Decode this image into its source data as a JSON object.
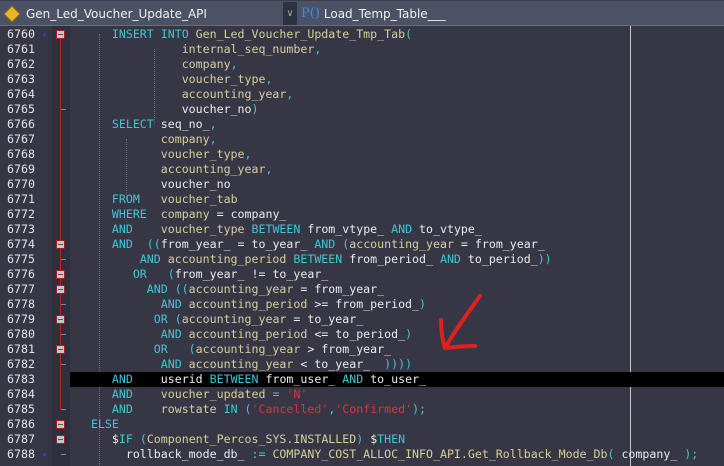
{
  "header": {
    "object_name": "Gen_Led_Voucher_Update_API",
    "object_icon": "package-icon",
    "procedure_name": "Load_Temp_Table___",
    "procedure_icon": "procedure-icon",
    "dropdown_icon": "chevron-down-icon"
  },
  "colors": {
    "keyword": "#3ec8d6",
    "column": "#d8cf9c",
    "string": "#d23a3a",
    "annotation_arrow": "#e02020"
  },
  "editor": {
    "highlighted_line": "6783",
    "lines": [
      {
        "n": "6760",
        "fold": "box",
        "bp": true,
        "seg": [
          [
            "",
            "      "
          ],
          [
            "k",
            "INSERT INTO "
          ],
          [
            "c",
            "Gen_Led_Voucher_Update_Tmp_Tab"
          ],
          [
            "p",
            "("
          ]
        ]
      },
      {
        "n": "6761",
        "seg": [
          [
            "",
            "                "
          ],
          [
            "c",
            "internal_seq_number"
          ],
          [
            "p",
            ","
          ]
        ]
      },
      {
        "n": "6762",
        "seg": [
          [
            "",
            "                "
          ],
          [
            "c",
            "company"
          ],
          [
            "p",
            ","
          ]
        ]
      },
      {
        "n": "6763",
        "seg": [
          [
            "",
            "                "
          ],
          [
            "c",
            "voucher_type"
          ],
          [
            "p",
            ","
          ]
        ]
      },
      {
        "n": "6764",
        "seg": [
          [
            "",
            "                "
          ],
          [
            "c",
            "accounting_year"
          ],
          [
            "p",
            ","
          ]
        ]
      },
      {
        "n": "6765",
        "fold": "tick",
        "seg": [
          [
            "",
            "                "
          ],
          [
            "v",
            "voucher_no"
          ],
          [
            "p",
            ")"
          ]
        ]
      },
      {
        "n": "6766",
        "seg": [
          [
            "",
            "      "
          ],
          [
            "k",
            "SELECT "
          ],
          [
            "v",
            "seq_no_"
          ],
          [
            "p",
            ","
          ]
        ]
      },
      {
        "n": "6767",
        "seg": [
          [
            "",
            "             "
          ],
          [
            "c",
            "company"
          ],
          [
            "p",
            ","
          ]
        ]
      },
      {
        "n": "6768",
        "seg": [
          [
            "",
            "             "
          ],
          [
            "c",
            "voucher_type"
          ],
          [
            "p",
            ","
          ]
        ]
      },
      {
        "n": "6769",
        "seg": [
          [
            "",
            "             "
          ],
          [
            "c",
            "accounting_year"
          ],
          [
            "p",
            ","
          ]
        ]
      },
      {
        "n": "6770",
        "seg": [
          [
            "",
            "             "
          ],
          [
            "v",
            "voucher_no"
          ]
        ]
      },
      {
        "n": "6771",
        "seg": [
          [
            "",
            "      "
          ],
          [
            "k",
            "FROM   "
          ],
          [
            "c",
            "voucher_tab"
          ]
        ]
      },
      {
        "n": "6772",
        "seg": [
          [
            "",
            "      "
          ],
          [
            "k",
            "WHERE  "
          ],
          [
            "c",
            "company "
          ],
          [
            "v",
            "= company_"
          ]
        ]
      },
      {
        "n": "6773",
        "seg": [
          [
            "",
            "      "
          ],
          [
            "k",
            "AND    "
          ],
          [
            "c",
            "voucher_type "
          ],
          [
            "k",
            "BETWEEN "
          ],
          [
            "v",
            "from_vtype_ "
          ],
          [
            "k",
            "AND "
          ],
          [
            "v",
            "to_vtype_"
          ]
        ]
      },
      {
        "n": "6774",
        "fold": "box",
        "seg": [
          [
            "",
            "      "
          ],
          [
            "k",
            "AND  "
          ],
          [
            "p",
            "(("
          ],
          [
            "v",
            "from_year_ = to_year_ "
          ],
          [
            "k",
            "AND "
          ],
          [
            "p",
            "("
          ],
          [
            "c",
            "accounting_year "
          ],
          [
            "v",
            "= from_year_"
          ]
        ]
      },
      {
        "n": "6775",
        "fold": "tick",
        "seg": [
          [
            "",
            "          "
          ],
          [
            "k",
            "AND "
          ],
          [
            "c",
            "accounting_period "
          ],
          [
            "k",
            "BETWEEN "
          ],
          [
            "v",
            "from_period_ "
          ],
          [
            "k",
            "AND "
          ],
          [
            "v",
            "to_period_"
          ],
          [
            "p",
            "))"
          ]
        ]
      },
      {
        "n": "6776",
        "fold": "box",
        "seg": [
          [
            "",
            "         "
          ],
          [
            "k",
            "OR   "
          ],
          [
            "p",
            "("
          ],
          [
            "v",
            "from_year_ != to_year_"
          ]
        ]
      },
      {
        "n": "6777",
        "fold": "box",
        "seg": [
          [
            "",
            "           "
          ],
          [
            "k",
            "AND "
          ],
          [
            "p",
            "(("
          ],
          [
            "c",
            "accounting_year "
          ],
          [
            "v",
            "= from_year_"
          ]
        ]
      },
      {
        "n": "6778",
        "fold": "tick",
        "seg": [
          [
            "",
            "             "
          ],
          [
            "k",
            "AND "
          ],
          [
            "c",
            "accounting_period "
          ],
          [
            "v",
            ">= from_period_"
          ],
          [
            "p",
            ")"
          ]
        ]
      },
      {
        "n": "6779",
        "fold": "box",
        "seg": [
          [
            "",
            "            "
          ],
          [
            "k",
            "OR "
          ],
          [
            "p",
            "("
          ],
          [
            "c",
            "accounting_year "
          ],
          [
            "v",
            "= to_year_"
          ]
        ]
      },
      {
        "n": "6780",
        "fold": "tick",
        "seg": [
          [
            "",
            "             "
          ],
          [
            "k",
            "AND "
          ],
          [
            "c",
            "accounting_period "
          ],
          [
            "v",
            "<= to_period_"
          ],
          [
            "p",
            ")"
          ]
        ]
      },
      {
        "n": "6781",
        "fold": "box",
        "seg": [
          [
            "",
            "            "
          ],
          [
            "k",
            "OR   "
          ],
          [
            "p",
            "("
          ],
          [
            "c",
            "accounting_year "
          ],
          [
            "v",
            "> from_year_"
          ]
        ]
      },
      {
        "n": "6782",
        "fold": "tick",
        "seg": [
          [
            "",
            "             "
          ],
          [
            "k",
            "AND "
          ],
          [
            "c",
            "accounting_year "
          ],
          [
            "v",
            "< to_year_  "
          ],
          [
            "p",
            "))))"
          ]
        ]
      },
      {
        "n": "6783",
        "seg": [
          [
            "",
            "      "
          ],
          [
            "k",
            "AND    "
          ],
          [
            "v",
            "userid "
          ],
          [
            "k",
            "BETWEEN "
          ],
          [
            "v",
            "from_user_ "
          ],
          [
            "k",
            "AND "
          ],
          [
            "v",
            "to_user_"
          ]
        ]
      },
      {
        "n": "6784",
        "seg": [
          [
            "",
            "      "
          ],
          [
            "k",
            "AND    "
          ],
          [
            "c",
            "voucher_updated "
          ],
          [
            "p",
            "= "
          ],
          [
            "s",
            "'N'"
          ]
        ]
      },
      {
        "n": "6785",
        "fold": "tick",
        "seg": [
          [
            "",
            "      "
          ],
          [
            "k",
            "AND    "
          ],
          [
            "c",
            "rowstate "
          ],
          [
            "k",
            "IN "
          ],
          [
            "p",
            "("
          ],
          [
            "s",
            "'Cancelled'"
          ],
          [
            "p",
            ","
          ],
          [
            "s",
            "'Confirmed'"
          ],
          [
            "p",
            ");"
          ]
        ]
      },
      {
        "n": "6786",
        "fold": "box",
        "seg": [
          [
            "",
            "   "
          ],
          [
            "k",
            "ELSE"
          ]
        ]
      },
      {
        "n": "6787",
        "fold": "box",
        "seg": [
          [
            "",
            "      "
          ],
          [
            "v",
            "$"
          ],
          [
            "k",
            "IF "
          ],
          [
            "p",
            "("
          ],
          [
            "c",
            "Component_Percos_SYS.INSTALLED"
          ],
          [
            "p",
            ") "
          ],
          [
            "v",
            "$"
          ],
          [
            "k",
            "THEN"
          ]
        ]
      },
      {
        "n": "6788",
        "fold": "tick",
        "bp": true,
        "seg": [
          [
            "",
            "        "
          ],
          [
            "v",
            "rollback_mode_db_ "
          ],
          [
            "p",
            ":= "
          ],
          [
            "c",
            "COMPANY_COST_ALLOC_INFO_API.Get_Rollback_Mode_Db"
          ],
          [
            "p",
            "( "
          ],
          [
            "v",
            "company_ "
          ],
          [
            "p",
            ");"
          ]
        ]
      }
    ]
  }
}
